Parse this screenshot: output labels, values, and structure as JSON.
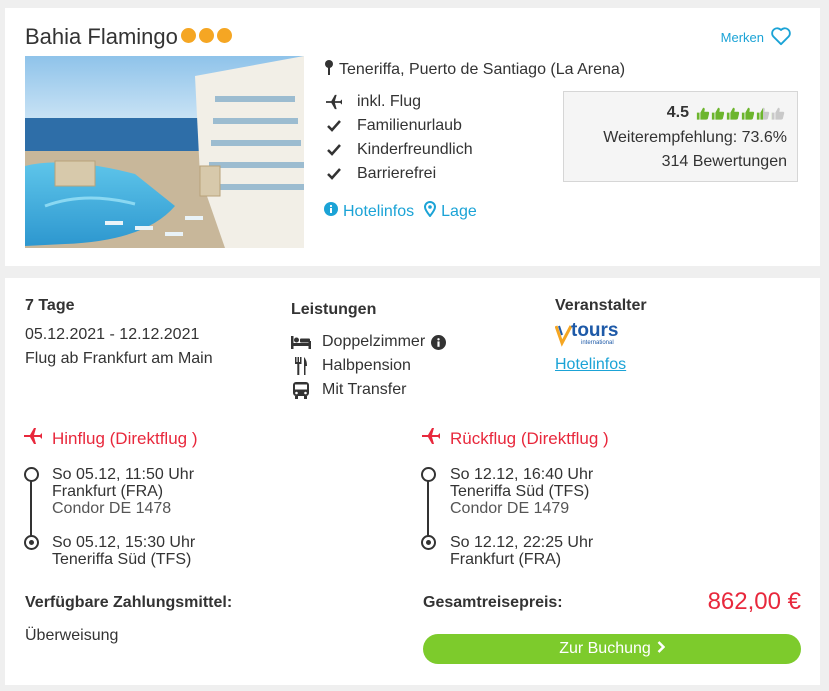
{
  "hotel": {
    "name": "Bahia Flamingo",
    "stars": 3,
    "merken_label": "Merken",
    "location": "Teneriffa, Puerto de Santiago (La Arena)",
    "features": [
      {
        "icon": "plane-icon",
        "label": "inkl. Flug"
      },
      {
        "icon": "check-icon",
        "label": "Familienurlaub"
      },
      {
        "icon": "check-icon",
        "label": "Kinderfreundlich"
      },
      {
        "icon": "check-icon",
        "label": "Barrierefrei"
      }
    ],
    "links": {
      "hotelinfos": "Hotelinfos",
      "lage": "Lage"
    },
    "rating": {
      "score": "4.5",
      "thumbs_total": 6,
      "thumbs_filled": 4.5,
      "recommendation": "Weiterempfehlung: 73.6%",
      "reviews": "314 Bewertungen"
    }
  },
  "offer": {
    "duration": "7 Tage",
    "dates": "05.12.2021 - 12.12.2021",
    "departure": "Flug ab Frankfurt am Main",
    "leistungen": {
      "title": "Leistungen",
      "items": [
        {
          "icon": "bed-icon",
          "label": "Doppelzimmer",
          "info": true
        },
        {
          "icon": "cutlery-icon",
          "label": "Halbpension",
          "info": false
        },
        {
          "icon": "bus-icon",
          "label": "Mit Transfer",
          "info": false
        }
      ]
    },
    "veranstalter": {
      "title": "Veranstalter",
      "logo_text": "tours",
      "logo_sub": "international",
      "link": "Hotelinfos"
    },
    "outbound": {
      "title": "Hinflug (Direktflug )",
      "dep_time": "So 05.12, 11:50 Uhr",
      "dep_airport": "Frankfurt (FRA)",
      "flight": "Condor DE 1478",
      "arr_time": "So 05.12, 15:30 Uhr",
      "arr_airport": "Teneriffa Süd (TFS)"
    },
    "return": {
      "title": "Rückflug (Direktflug )",
      "dep_time": "So 12.12, 16:40 Uhr",
      "dep_airport": "Teneriffa Süd (TFS)",
      "flight": "Condor DE 1479",
      "arr_time": "So 12.12, 22:25 Uhr",
      "arr_airport": "Frankfurt (FRA)"
    },
    "payment_title": "Verfügbare Zahlungsmittel:",
    "payment_method": "Überweisung",
    "total_label": "Gesamtreisepreis:",
    "total_price": "862,00 €",
    "book_label": "Zur Buchung"
  },
  "colors": {
    "accent_blue": "#1ba3d6",
    "price_red": "#e8283c",
    "button_green": "#7dcb2c",
    "star_orange": "#f5a623",
    "thumb_green": "#6cb52d"
  }
}
